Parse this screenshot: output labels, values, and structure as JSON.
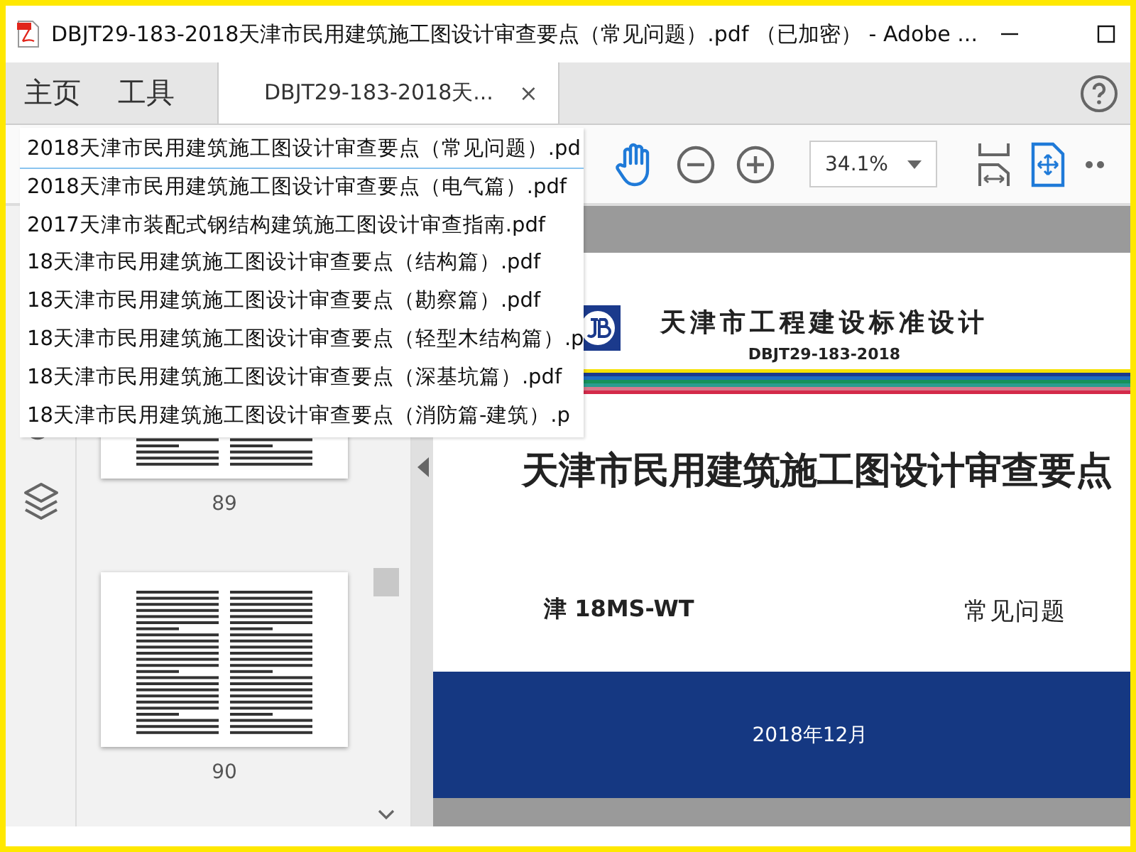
{
  "window": {
    "title": "DBJT29-183-2018天津市民用建筑施工图设计审查要点（常见问题）.pdf （已加密） - Adobe ..."
  },
  "menu_tabs": [
    {
      "label": "主页",
      "selected": false
    },
    {
      "label": "工具",
      "selected": false
    }
  ],
  "document_tab": {
    "label": "DBJT29-183-2018天...",
    "selected": true,
    "close": "×"
  },
  "toolbar": {
    "zoom": "34.1%"
  },
  "file_dropdown": {
    "items": [
      {
        "label": "2018天津市民用建筑施工图设计审查要点（常见问题）.pd",
        "selected": true
      },
      {
        "label": "2018天津市民用建筑施工图设计审查要点（电气篇）.pdf",
        "selected": false
      },
      {
        "label": "2017天津市装配式钢结构建筑施工图设计审查指南.pdf",
        "selected": false
      },
      {
        "label": "18天津市民用建筑施工图设计审查要点（结构篇）.pdf",
        "selected": false
      },
      {
        "label": "18天津市民用建筑施工图设计审查要点（勘察篇）.pdf",
        "selected": false
      },
      {
        "label": "18天津市民用建筑施工图设计审查要点（轻型木结构篇）.p",
        "selected": false
      },
      {
        "label": "18天津市民用建筑施工图设计审查要点（深基坑篇）.pdf",
        "selected": false
      },
      {
        "label": "18天津市民用建筑施工图设计审查要点（消防篇-建筑）.p",
        "selected": false
      }
    ]
  },
  "thumbnails": [
    {
      "page": "89",
      "selected": false
    },
    {
      "page": "90",
      "selected": false
    }
  ],
  "document_page": {
    "publisher": "天津市工程建设标准设计",
    "code": "DBJT29-183-2018",
    "title": "天津市民用建筑施工图设计审查要点",
    "series": "津 18MS-WT",
    "subtitle": "常见问题",
    "date": "2018年12月"
  }
}
